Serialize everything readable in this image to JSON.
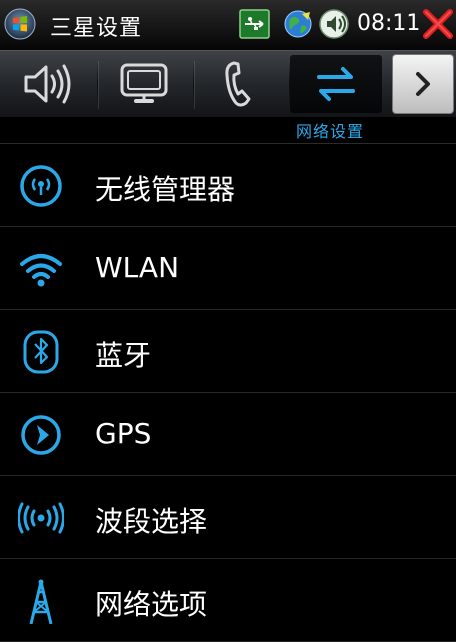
{
  "title_bar": {
    "app_title": "三星设置",
    "clock": "08:11",
    "icons": [
      "windows-start-orb",
      "usb-connection",
      "network-globe",
      "volume",
      "close"
    ]
  },
  "toolbar": {
    "tabs": [
      {
        "name": "sound",
        "icon": "speaker-icon"
      },
      {
        "name": "display",
        "icon": "monitor-icon"
      },
      {
        "name": "phone",
        "icon": "phone-handset-icon"
      },
      {
        "name": "network",
        "icon": "network-arrows-icon",
        "active": true
      }
    ],
    "active_caption": "网络设置",
    "next_icon": "chevron-right-icon"
  },
  "list": {
    "items": [
      {
        "label": "无线管理器",
        "icon": "wireless-manager-icon"
      },
      {
        "label": "WLAN",
        "icon": "wifi-icon"
      },
      {
        "label": "蓝牙",
        "icon": "bluetooth-icon"
      },
      {
        "label": "GPS",
        "icon": "gps-icon"
      },
      {
        "label": "波段选择",
        "icon": "band-select-icon"
      },
      {
        "label": "网络选项",
        "icon": "antenna-tower-icon"
      }
    ]
  },
  "colors": {
    "accent": "#2aa9ea",
    "background": "#000000",
    "text": "#ffffff",
    "close": "#e02020"
  }
}
